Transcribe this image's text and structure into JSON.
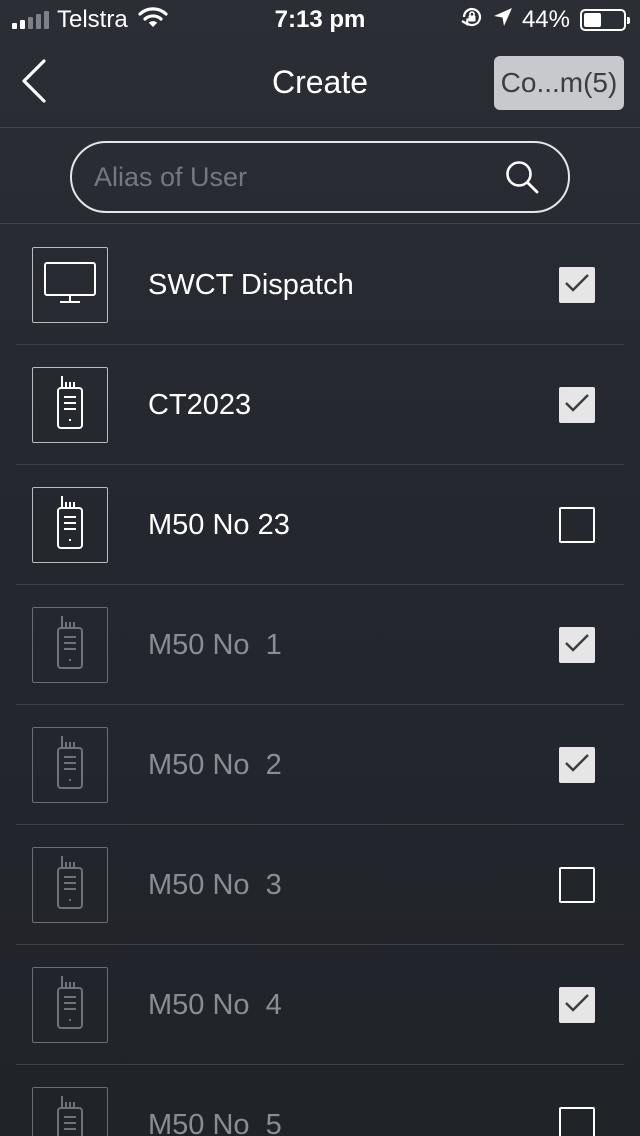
{
  "status_bar": {
    "carrier": "Telstra",
    "time": "7:13 pm",
    "battery": "44%",
    "battery_level": 0.44,
    "signal_bars": 2
  },
  "nav": {
    "title": "Create",
    "confirm_label": "Co...m(5)"
  },
  "search": {
    "placeholder": "Alias of User",
    "value": ""
  },
  "users": [
    {
      "name": "SWCT Dispatch",
      "icon": "monitor-icon",
      "checked": true,
      "online": true
    },
    {
      "name": "CT2023",
      "icon": "radio-icon",
      "checked": true,
      "online": true
    },
    {
      "name": "M50 No 23",
      "icon": "radio-icon",
      "checked": false,
      "online": true
    },
    {
      "name": "M50 No  1",
      "icon": "radio-icon",
      "checked": true,
      "online": false
    },
    {
      "name": "M50 No  2",
      "icon": "radio-icon",
      "checked": true,
      "online": false
    },
    {
      "name": "M50 No  3",
      "icon": "radio-icon",
      "checked": false,
      "online": false
    },
    {
      "name": "M50 No  4",
      "icon": "radio-icon",
      "checked": true,
      "online": false
    },
    {
      "name": "M50 No  5",
      "icon": "radio-icon",
      "checked": false,
      "online": false
    }
  ],
  "colors": {
    "background": "#23262d",
    "confirm_button": "#c8c9cc",
    "checkbox_checked": "#e6e6e6",
    "offline_text": "#8a8d93"
  }
}
